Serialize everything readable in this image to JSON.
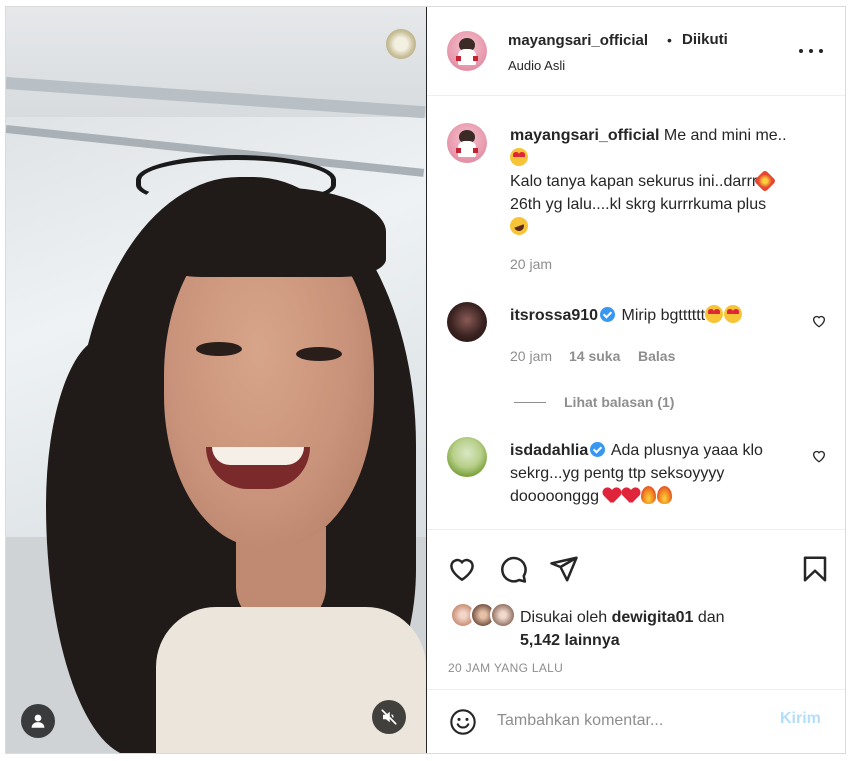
{
  "post": {
    "username": "mayangsari_official",
    "follow_status": "Diikuti",
    "separator": "•",
    "audio": "Audio Asli"
  },
  "caption": {
    "username": "mayangsari_official",
    "line1": "Me and mini me..",
    "line2": "Kalo tanya kapan sekurus ini..darrr",
    "line3": "26th yg lalu....kl skrg kurrrkuma plus",
    "time": "20 jam"
  },
  "comments": [
    {
      "username": "itsrossa910",
      "verified": true,
      "text": "Mirip bgtttttt",
      "time": "20 jam",
      "likes": "14 suka",
      "reply_label": "Balas",
      "view_replies": "Lihat balasan (1)"
    },
    {
      "username": "isdadahlia",
      "verified": true,
      "text_line1": "Ada plusnya yaaa klo",
      "text_line2": "sekrg...yg pentg ttp seksoyyyy",
      "text_line3": "dooooonggg"
    }
  ],
  "likes": {
    "prefix": "Disukai oleh",
    "user": "dewigita01",
    "joiner": "dan",
    "others": "5,142 lainnya"
  },
  "post_time": "20 JAM YANG LALU",
  "comment_box": {
    "placeholder": "Tambahkan komentar...",
    "post_label": "Kirim"
  },
  "icons": {
    "user_tag": "user-icon",
    "mute": "speaker-muted-icon",
    "more": "more-horizontal-icon",
    "like": "heart-icon",
    "comment": "comment-icon",
    "share": "send-icon",
    "save": "bookmark-icon",
    "emoji": "emoji-icon"
  },
  "colors": {
    "accent": "#3897f0",
    "post_disabled": "#b2dffc",
    "muted_text": "#8e8e8e"
  }
}
